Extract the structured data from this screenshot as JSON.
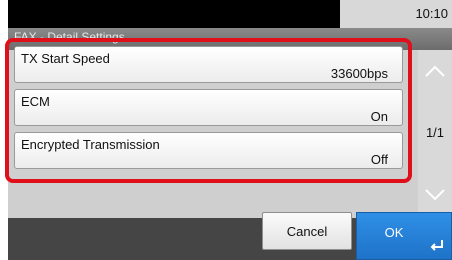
{
  "status": {
    "time": "10:10"
  },
  "screen": {
    "title": "FAX - Detail Settings"
  },
  "settings": [
    {
      "label": "TX Start Speed",
      "value": "33600bps"
    },
    {
      "label": "ECM",
      "value": "On"
    },
    {
      "label": "Encrypted Transmission",
      "value": "Off"
    }
  ],
  "pager": {
    "page": "1/1"
  },
  "buttons": {
    "cancel": "Cancel",
    "ok": "OK"
  },
  "colors": {
    "highlight": "#e0101a",
    "ok_button": "#1e73c8"
  },
  "icons": {
    "scroll_up": "chevron-up-icon",
    "scroll_down": "chevron-down-icon",
    "ok": "enter-icon"
  }
}
